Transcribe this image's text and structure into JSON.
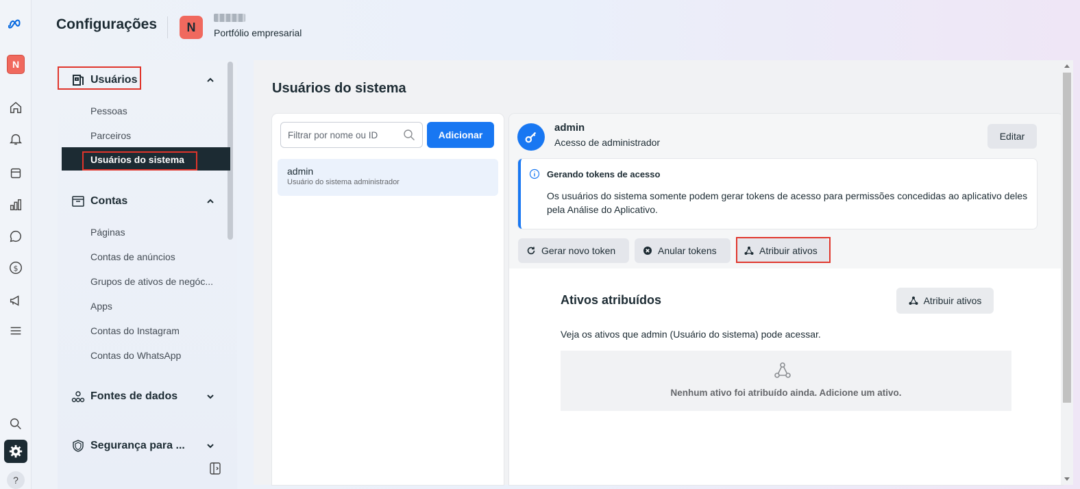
{
  "header": {
    "title": "Configurações",
    "business_initial": "N",
    "business_subtitle": "Portfólio empresarial"
  },
  "rail": {
    "avatar_initial": "N",
    "help_label": "?",
    "icons": [
      "meta-logo-icon",
      "home-icon",
      "bell-icon",
      "pages-icon",
      "chart-icon",
      "chat-icon",
      "dollar-icon",
      "megaphone-icon",
      "menu-icon",
      "search-icon",
      "gear-icon",
      "help-icon"
    ]
  },
  "sidebar": {
    "users_section": "Usuários",
    "users_items": [
      "Pessoas",
      "Parceiros",
      "Usuários do sistema"
    ],
    "accounts_section": "Contas",
    "accounts_items": [
      "Páginas",
      "Contas de anúncios",
      "Grupos de ativos de negóc...",
      "Apps",
      "Contas do Instagram",
      "Contas do WhatsApp"
    ],
    "data_sources_section": "Fontes de dados",
    "security_section": "Segurança para ..."
  },
  "main": {
    "title": "Usuários do sistema",
    "search_placeholder": "Filtrar por nome ou ID",
    "add_label": "Adicionar",
    "user": {
      "name": "admin",
      "subtitle": "Usuário do sistema administrador"
    }
  },
  "detail": {
    "name": "admin",
    "role": "Acesso de administrador",
    "edit_label": "Editar",
    "info_title": "Gerando tokens de acesso",
    "info_text": "Os usuários do sistema somente podem gerar tokens de acesso para permissões concedidas ao aplicativo deles pela Análise do Aplicativo.",
    "btn_generate": "Gerar novo token",
    "btn_revoke": "Anular tokens",
    "btn_assign": "Atribuir ativos",
    "assigned_title": "Ativos atribuídos",
    "assign_btn2": "Atribuir ativos",
    "assigned_desc": "Veja os ativos que admin (Usuário do sistema) pode acessar.",
    "empty_text": "Nenhum ativo foi atribuído ainda. Adicione um ativo."
  },
  "colors": {
    "accent": "#1877f2",
    "brand_avatar": "#f0695e",
    "highlight": "#e0352b",
    "active_nav": "#1c2b33"
  }
}
